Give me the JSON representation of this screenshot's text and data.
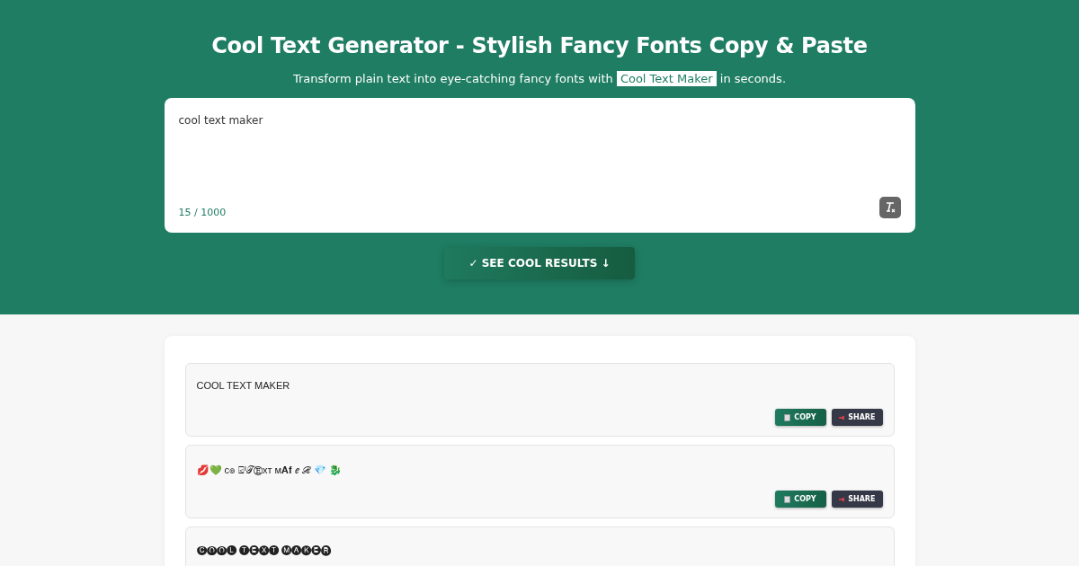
{
  "header": {
    "title": "Cool Text Generator - Stylish Fancy Fonts Copy & Paste",
    "subtitle_before": "Transform plain text into eye-catching fancy fonts with",
    "subtitle_highlight": "Cool Text Maker",
    "subtitle_after": "in seconds."
  },
  "editor": {
    "value": "cool text maker",
    "counter": "15 / 1000"
  },
  "submit_button": "✓ SEE COOL RESULTS ↓",
  "results": [
    {
      "text": "COOL TEXT MAKER",
      "kind": "full",
      "copy": "COPY",
      "share": "SHARE"
    },
    {
      "text": "💋💚 c๏ ⍃ᴵ𝒯Ⓔxт ᴍ𝐀𝐟 ℯ ℛ 💎 🐉",
      "kind": "full",
      "copy": "COPY",
      "share": "SHARE"
    },
    {
      "text": "🅒🅞🅞🅛 🅣🅔🅧🅣 🅜🅐🅚🅔🅡",
      "kind": "cut"
    }
  ]
}
